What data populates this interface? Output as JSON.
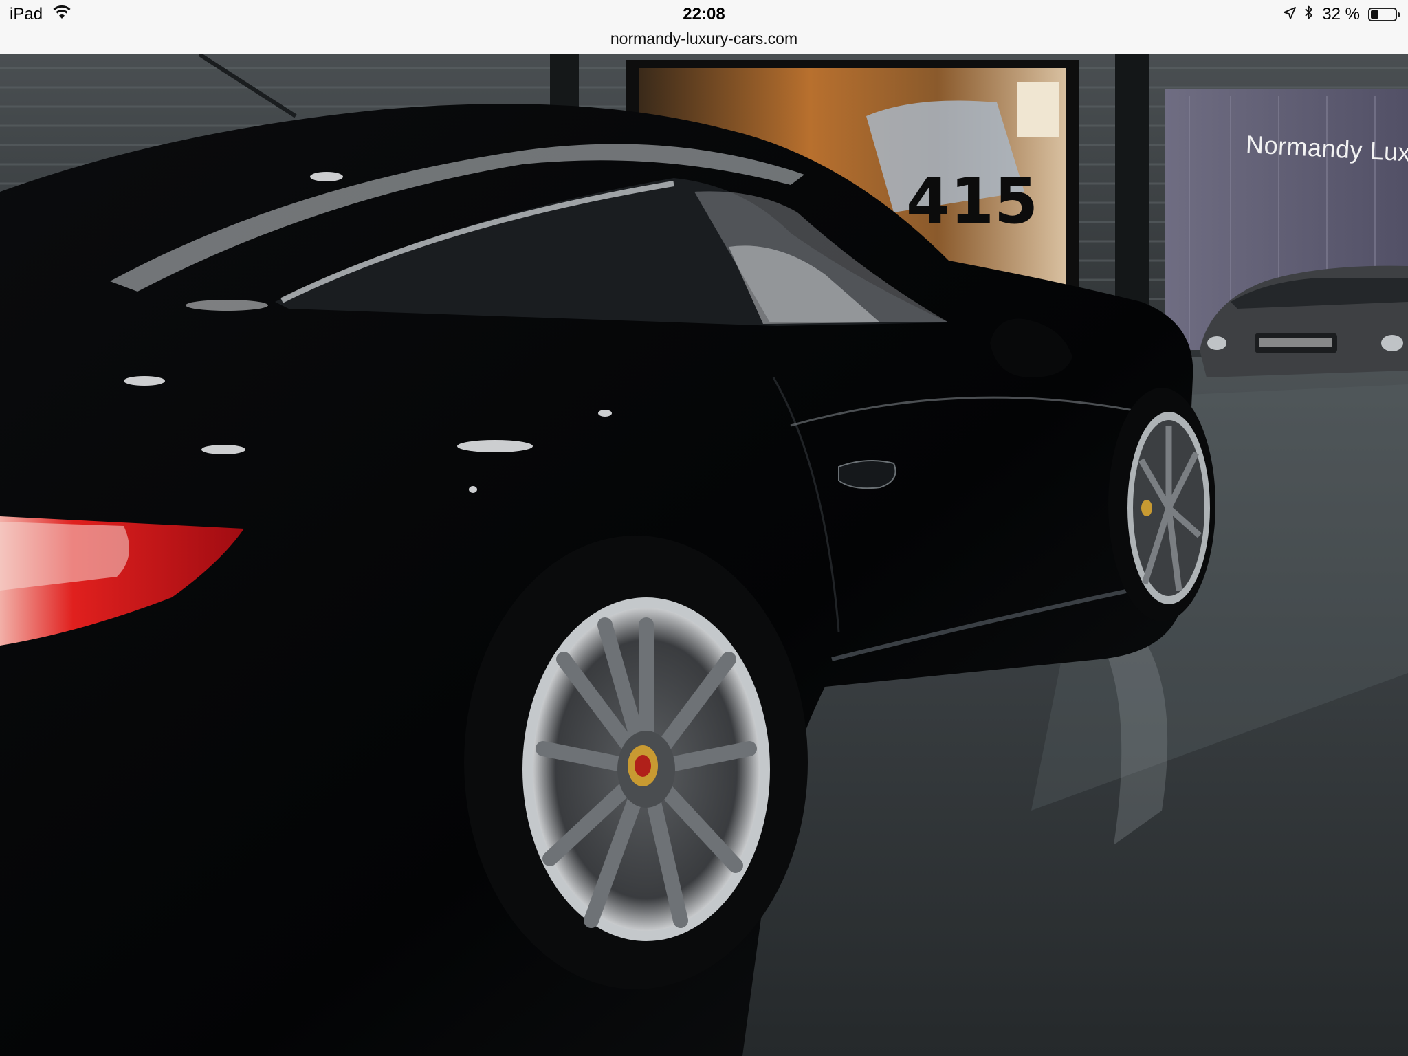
{
  "status_bar": {
    "device": "iPad",
    "time": "22:08",
    "battery_text": "32 %",
    "battery_level": 0.32,
    "icons": [
      "wifi-icon",
      "location-arrow-icon",
      "bluetooth-icon",
      "battery-icon"
    ]
  },
  "url_bar": {
    "host": "normandy-luxury-cars.com"
  },
  "photo": {
    "banner_text": "Normandy Luxury Cars",
    "poster_number": "415"
  },
  "colors": {
    "bar_bg": "#f7f7f7",
    "car_body": "#050608",
    "floor": "#3a3f42",
    "taillight": "#d4141c"
  }
}
